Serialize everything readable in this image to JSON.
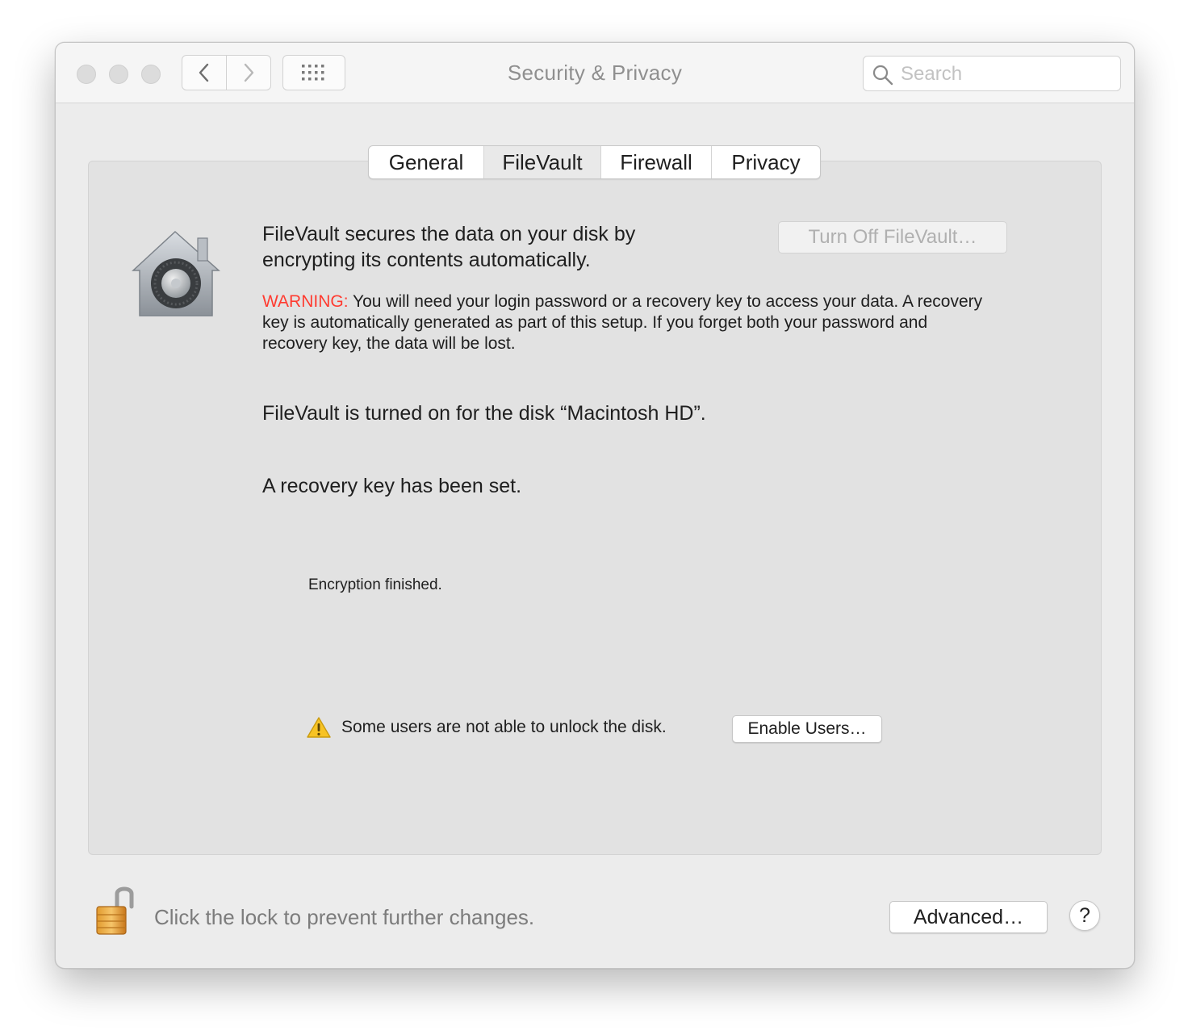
{
  "window": {
    "title": "Security & Privacy"
  },
  "toolbar": {
    "back_icon": "chevron-left-icon",
    "forward_icon": "chevron-right-icon",
    "grid_icon": "grid-icon"
  },
  "search": {
    "placeholder": "Search"
  },
  "tabs": [
    {
      "label": "General",
      "selected": false
    },
    {
      "label": "FileVault",
      "selected": true
    },
    {
      "label": "Firewall",
      "selected": false
    },
    {
      "label": "Privacy",
      "selected": false
    }
  ],
  "filevault": {
    "intro_line1": "FileVault secures the data on your disk by",
    "intro_line2": "encrypting its contents automatically.",
    "turn_off_label": "Turn Off FileVault…",
    "warning_label": "WARNING:",
    "warning_text": " You will need your login password or a recovery key to access your data. A recovery key is automatically generated as part of this setup. If you forget both your password and recovery key, the data will be lost.",
    "status_text": "FileVault is turned on for the disk “Macintosh HD”.",
    "recovery_text": "A recovery key has been set.",
    "encryption_text": "Encryption finished.",
    "users_warning": "Some users are not able to unlock the disk.",
    "enable_users_label": "Enable Users…"
  },
  "footer": {
    "lock_text": "Click the lock to prevent further changes.",
    "advanced_label": "Advanced…",
    "help_label": "?"
  },
  "colors": {
    "warning_red": "#ff3b30",
    "window_bg": "#ececec",
    "panel_bg": "#e2e2e2"
  }
}
